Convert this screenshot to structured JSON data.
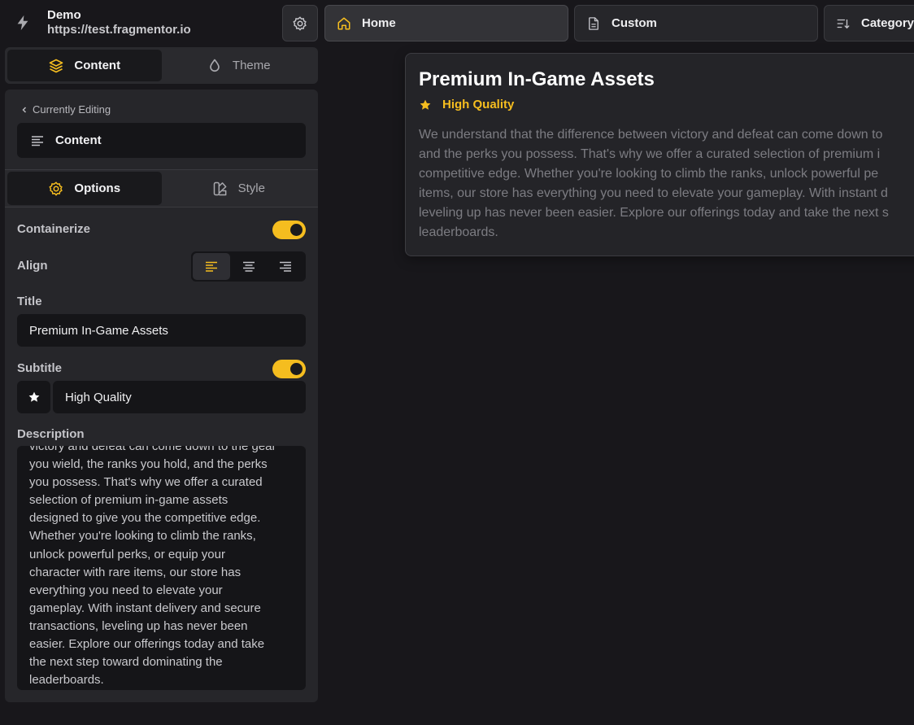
{
  "site": {
    "name": "Demo",
    "url": "https://test.fragmentor.io"
  },
  "sidebar_tabs": [
    {
      "label": "Content",
      "icon": "layers-icon"
    },
    {
      "label": "Theme",
      "icon": "droplet-icon"
    }
  ],
  "editor": {
    "breadcrumb": "Currently Editing",
    "editing_block": "Content",
    "option_tabs": [
      {
        "label": "Options",
        "icon": "gear-icon"
      },
      {
        "label": "Style",
        "icon": "swatch-icon"
      }
    ],
    "containerize_label": "Containerize",
    "containerize_on": true,
    "align_label": "Align",
    "align_selected": "left",
    "title_label": "Title",
    "title_value": "Premium In-Game Assets",
    "subtitle_label": "Subtitle",
    "subtitle_on": true,
    "subtitle_icon": "star-icon",
    "subtitle_value": "High Quality",
    "description_label": "Description",
    "description_visible": "victory and defeat can come down to the gear\nyou wield, the ranks you hold, and the perks\nyou possess. That's why we offer a curated\nselection of premium in-game assets\ndesigned to give you the competitive edge.\nWhether you're looking to climb the ranks,\nunlock powerful perks, or equip your\ncharacter with rare items, our store has\neverything you need to elevate your\ngameplay. With instant delivery and secure\ntransactions, leveling up has never been\neasier. Explore our offerings today and take\nthe next step toward dominating the\nleaderboards."
  },
  "nav": {
    "tabs": [
      {
        "label": "Home",
        "icon": "home-icon"
      },
      {
        "label": "Custom",
        "icon": "file-icon"
      },
      {
        "label": "Category",
        "icon": "sort-icon"
      }
    ]
  },
  "preview": {
    "title": "Premium In-Game Assets",
    "subtitle": "High Quality",
    "description": "We understand that the difference between victory and defeat can come down to\nand the perks you possess. That's why we offer a curated selection of premium i\ncompetitive edge. Whether you're looking to climb the ranks, unlock powerful pe\nitems, our store has everything you need to elevate your gameplay. With instant d\nleveling up has never been easier. Explore our offerings today and take the next s\nleaderboards."
  },
  "colors": {
    "accent": "#f5bd1f",
    "background": "#18171b",
    "panel": "#26262a",
    "input": "#151518"
  }
}
